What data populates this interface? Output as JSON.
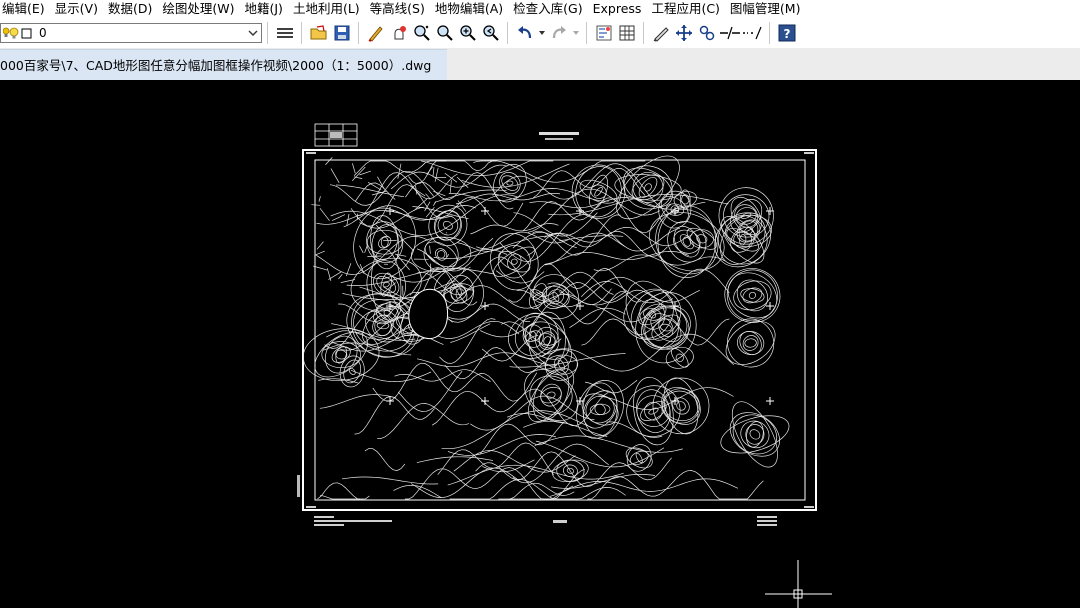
{
  "menubar": {
    "items": [
      "编辑(E)",
      "显示(V)",
      "数据(D)",
      "绘图处理(W)",
      "地籍(J)",
      "土地利用(L)",
      "等高线(S)",
      "地物编辑(A)",
      "检查入库(G)",
      "Express",
      "工程应用(C)",
      "图幅管理(M)"
    ]
  },
  "toolbar": {
    "layer_value": "0",
    "icons": [
      "layer-manager-icon",
      "open-folder-icon",
      "save-icon",
      "edit-pen-icon",
      "pan-realtime-icon",
      "zoom-window-icon",
      "zoom-realtime-icon",
      "zoom-in-icon",
      "zoom-previous-icon",
      "undo-icon",
      "redo-icon",
      "properties-icon",
      "grid-table-icon",
      "pencil-icon",
      "move-icon",
      "link-icon",
      "break-line-icon",
      "trim-line-icon",
      "help-icon"
    ]
  },
  "file_tab": {
    "path": "000百家号\\7、CAD地形图任意分幅加图框操作视频\\2000（1：5000）.dwg"
  },
  "colors": {
    "canvas": "#000000",
    "drawing_lines": "#ffffff",
    "tab_active": "#dbe6f4"
  }
}
